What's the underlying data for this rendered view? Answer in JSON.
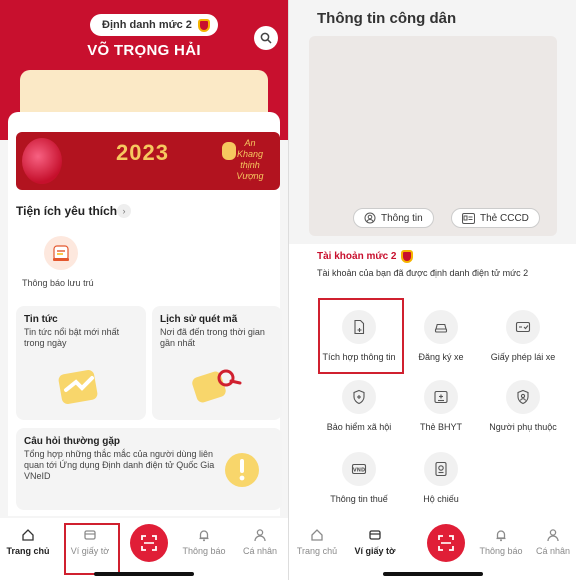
{
  "left": {
    "header": {
      "level_badge": "Định danh mức 2",
      "user_name": "VÕ TRỌNG HẢI"
    },
    "banner": {
      "year": "2023",
      "caption_line1": "An",
      "caption_line2": "Khang",
      "caption_line3": "thịnh",
      "caption_line4": "Vượng"
    },
    "favorites": {
      "title": "Tiện ích yêu thích",
      "chevron": "›",
      "items": [
        {
          "label": "Thông báo lưu trú",
          "icon": "accommodation-notice-icon"
        }
      ]
    },
    "cards": {
      "news": {
        "title": "Tin tức",
        "desc": "Tin tức nổi bật mới nhất trong ngày"
      },
      "scan_history": {
        "title": "Lịch sử quét mã",
        "desc": "Nơi đã đến trong thời gian gần nhất"
      },
      "faq": {
        "title": "Câu hỏi thường gặp",
        "desc": "Tổng hợp những thắc mắc của người dùng liên quan tới Ứng dụng Định danh điện tử Quốc Gia VNeID"
      }
    },
    "nav": {
      "home": "Trang chủ",
      "wallet": "Ví giấy tờ",
      "notifications": "Thông báo",
      "profile": "Cá nhân",
      "active": "home"
    }
  },
  "right": {
    "title": "Thông tin công dân",
    "pills": {
      "info": "Thông tin",
      "cccd": "Thẻ CCCD"
    },
    "account": {
      "title": "Tài khoản mức 2",
      "desc": "Tài khoản của bạn đã được định danh điện tử mức 2"
    },
    "services": [
      {
        "label": "Tích hợp thông tin",
        "icon": "document-add-icon"
      },
      {
        "label": "Đăng ký xe",
        "icon": "car-icon"
      },
      {
        "label": "Giấy phép lái xe",
        "icon": "driver-license-icon"
      },
      {
        "label": "Bảo hiểm xã hội",
        "icon": "shield-plus-icon"
      },
      {
        "label": "Thẻ BHYT",
        "icon": "health-card-icon"
      },
      {
        "label": "Người phụ thuộc",
        "icon": "dependent-icon"
      },
      {
        "label": "Thông tin thuế",
        "icon": "vnd-tax-icon"
      },
      {
        "label": "Hộ chiếu",
        "icon": "passport-icon"
      }
    ],
    "nav": {
      "home": "Trang chủ",
      "wallet": "Ví giấy tờ",
      "notifications": "Thông báo",
      "profile": "Cá nhân",
      "active": "wallet"
    }
  },
  "colors": {
    "brand_red": "#c8102e",
    "highlight_red": "#d0202f",
    "gold": "#f6c85f"
  }
}
